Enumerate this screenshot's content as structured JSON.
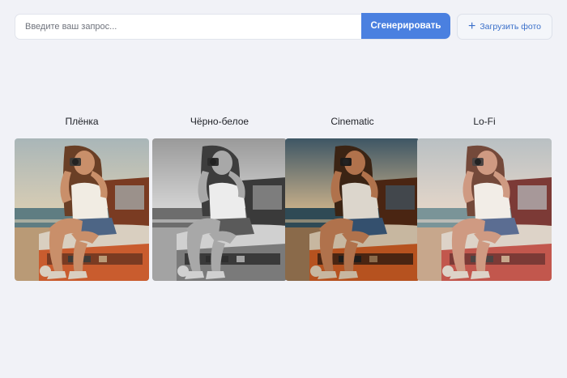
{
  "search": {
    "placeholder": "Введите ваш запрос...",
    "generate_label": "Сгенерировать"
  },
  "upload": {
    "label": "Загрузить фото",
    "icon": "plus-icon"
  },
  "filters": [
    {
      "title": "Плёнка",
      "style": "film"
    },
    {
      "title": "Чёрно-белое",
      "style": "bw"
    },
    {
      "title": "Cinematic",
      "style": "cinematic"
    },
    {
      "title": "Lo-Fi",
      "style": "lofi"
    }
  ],
  "colors": {
    "accent": "#4a80e0",
    "background": "#f1f2f7"
  }
}
